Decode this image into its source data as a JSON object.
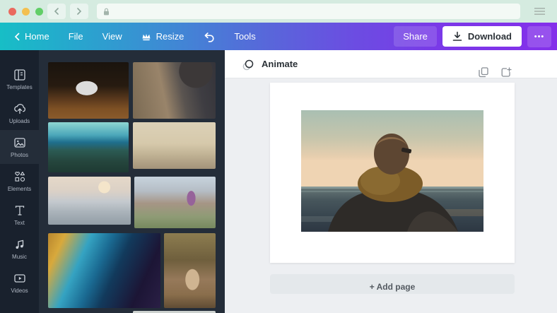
{
  "browser": {
    "url": ""
  },
  "menubar": {
    "home": "Home",
    "file": "File",
    "view": "View",
    "resize": "Resize",
    "tools": "Tools",
    "share": "Share",
    "download": "Download",
    "more": "•••"
  },
  "sidebar": {
    "items": [
      {
        "label": "Templates"
      },
      {
        "label": "Uploads"
      },
      {
        "label": "Photos"
      },
      {
        "label": "Elements"
      },
      {
        "label": "Text"
      },
      {
        "label": "Music"
      },
      {
        "label": "Videos"
      }
    ]
  },
  "photos_panel": {
    "thumbnails": [
      "laptop-on-wooden-desk",
      "person-typing-on-laptop",
      "forest-and-sea-coast",
      "sepia-beach-scene",
      "dunes-with-walker",
      "couple-walking-on-beach",
      "abstract-ocean-aerial",
      "deer-in-forest",
      "next-photo-partial"
    ]
  },
  "canvas": {
    "animate": "Animate",
    "add_page": "+ Add page"
  },
  "colors": {
    "accent_teal": "#17bec6",
    "accent_purple": "#7d2ae8",
    "sidebar_bg": "#19212d",
    "panel_bg": "#242d39"
  }
}
